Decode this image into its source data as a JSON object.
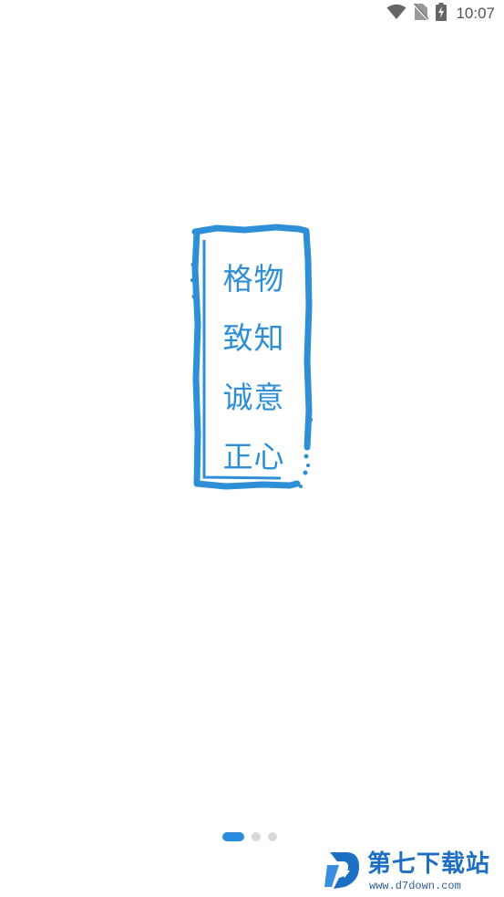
{
  "status_bar": {
    "time": "10:07",
    "icons": [
      "wifi-icon",
      "no-sim-icon",
      "battery-charging-icon"
    ]
  },
  "splash": {
    "seal_lines": [
      "格物",
      "致知",
      "诚意",
      "正心"
    ],
    "seal_color": "#2e8fd6"
  },
  "pager": {
    "page_count": 3,
    "active_index": 0,
    "active_color": "#2b8bde",
    "inactive_color": "#d9d9d9"
  },
  "watermark": {
    "title": "第七下载站",
    "url": "www.d7down.com",
    "color": "#1d6fc4"
  }
}
